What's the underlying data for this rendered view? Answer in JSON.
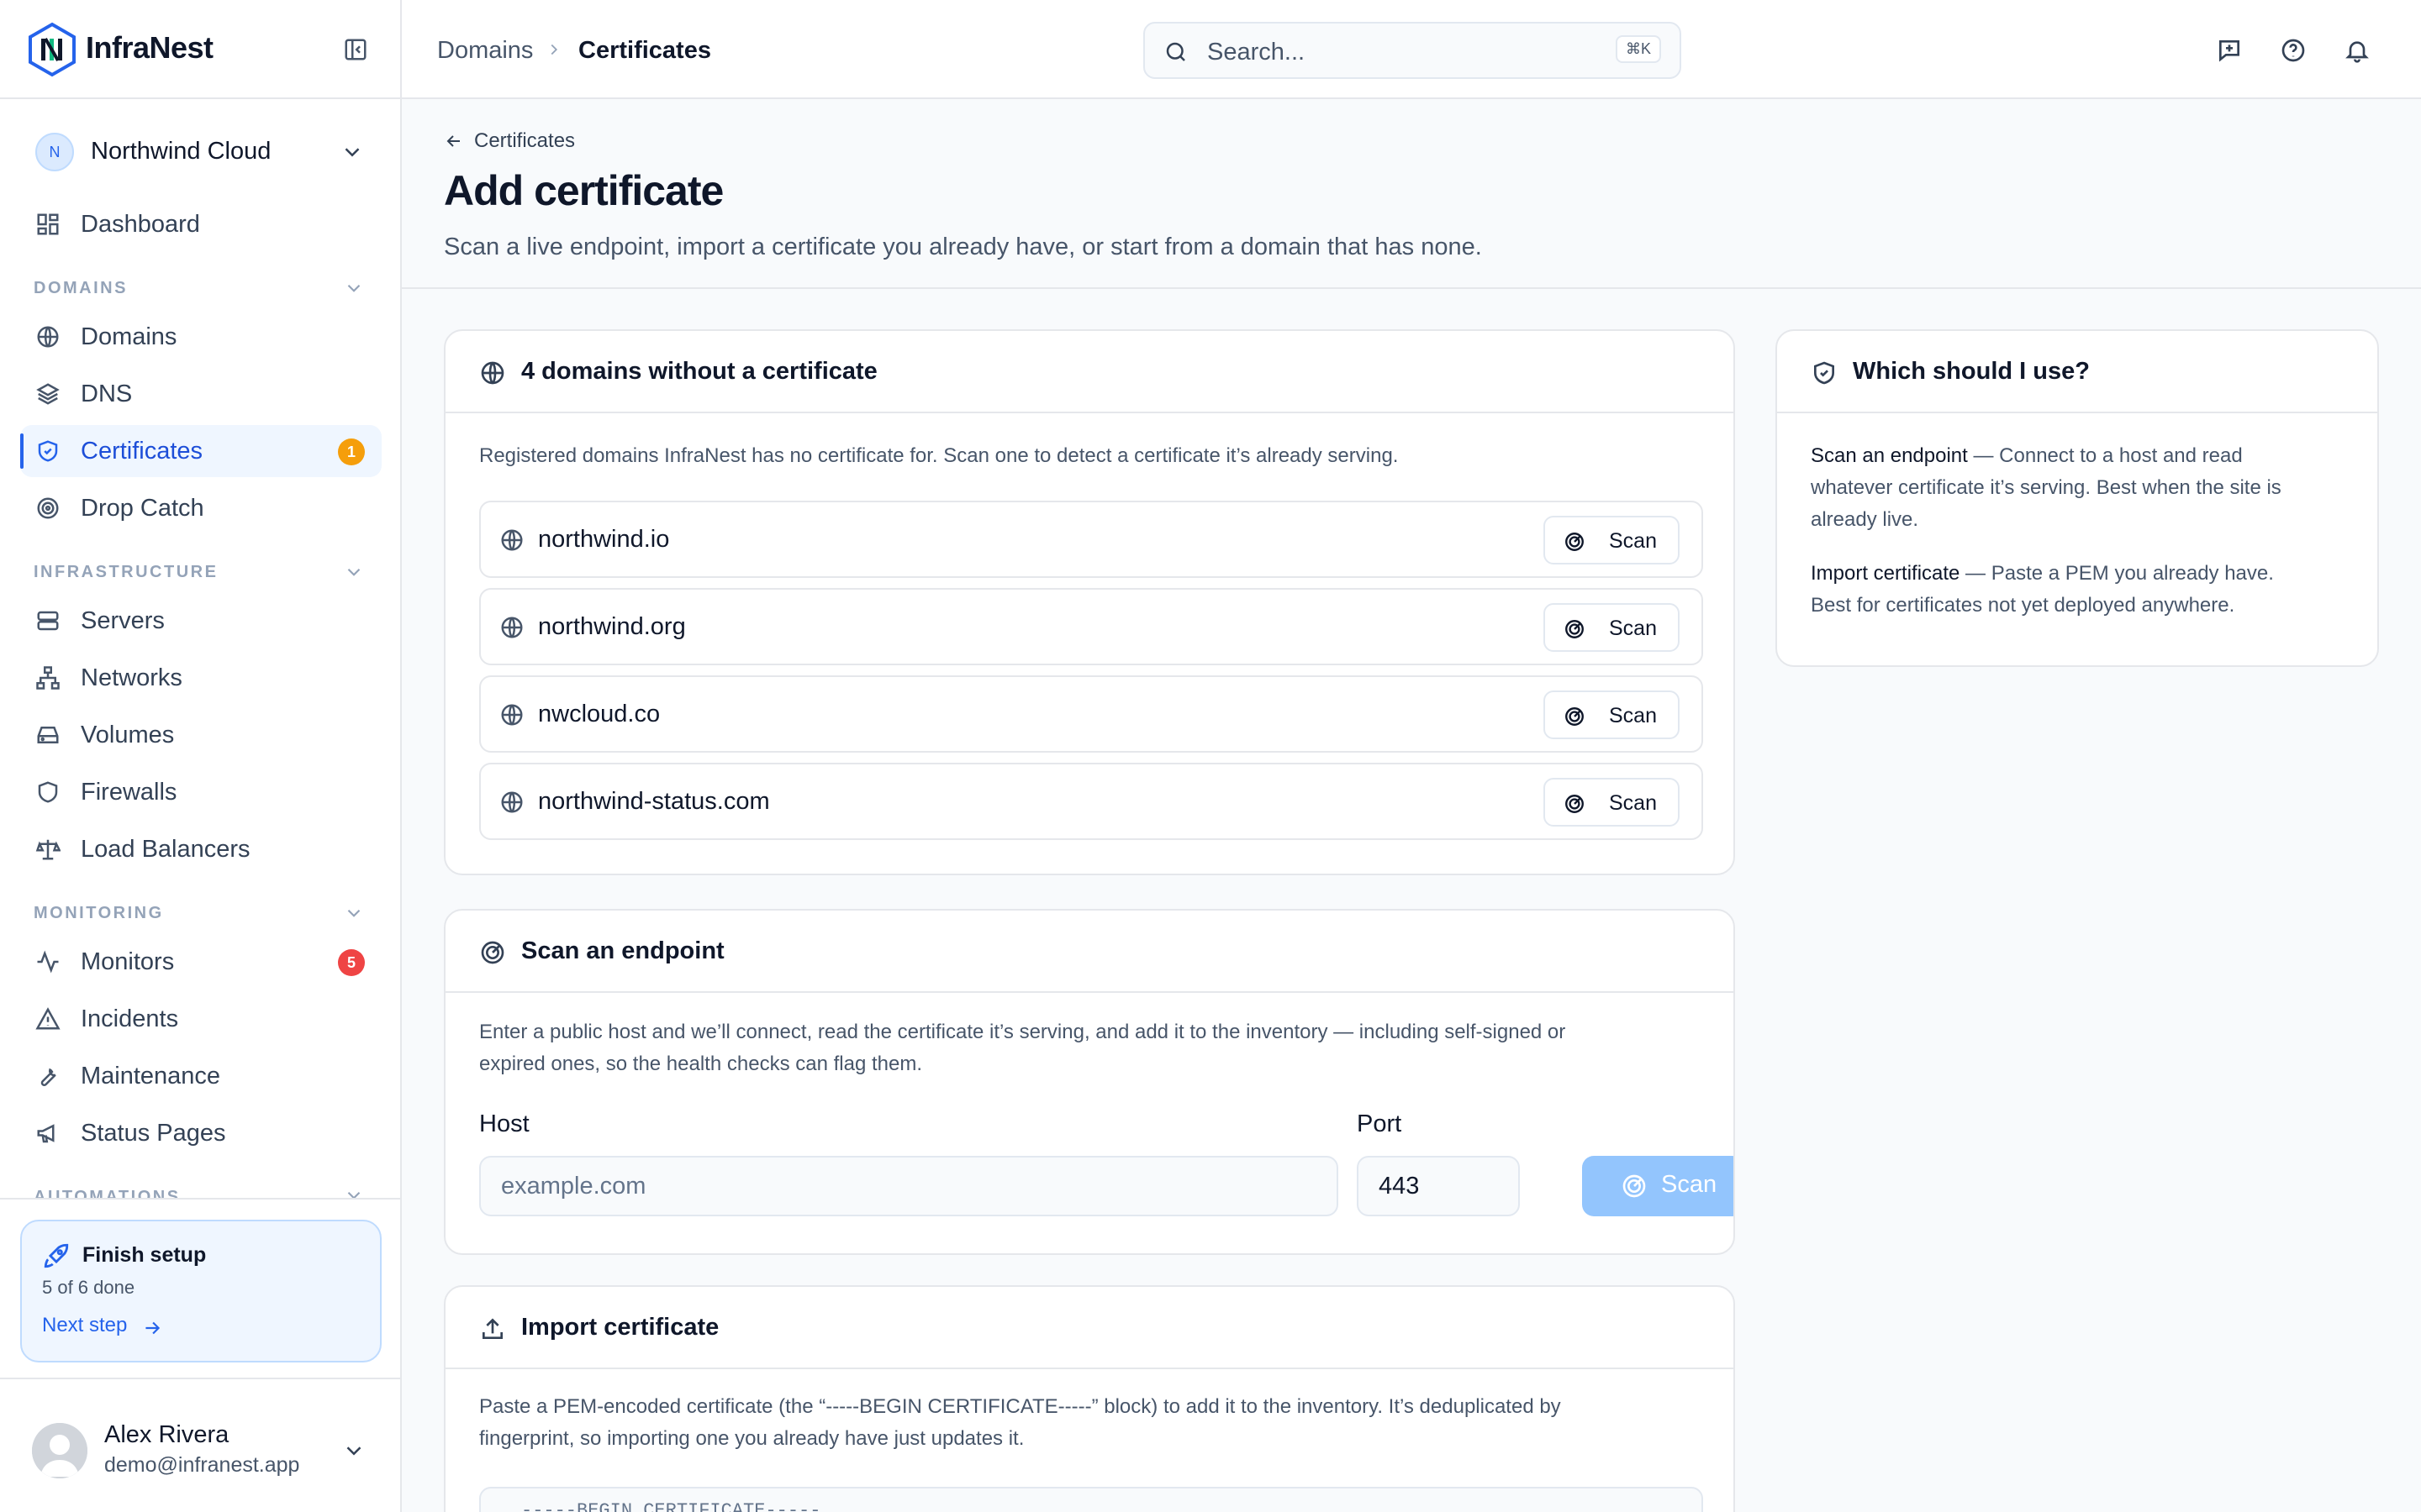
{
  "app": {
    "name": "InfraNest"
  },
  "org": {
    "initial": "N",
    "name": "Northwind Cloud"
  },
  "nav": {
    "dashboard": "Dashboard",
    "sections": {
      "domains": "DOMAINS",
      "infrastructure": "INFRASTRUCTURE",
      "monitoring": "MONITORING",
      "automations": "AUTOMATIONS"
    },
    "domains": "Domains",
    "dns": "DNS",
    "certificates": "Certificates",
    "certificates_badge": "1",
    "drop_catch": "Drop Catch",
    "servers": "Servers",
    "networks": "Networks",
    "volumes": "Volumes",
    "firewalls": "Firewalls",
    "load_balancers": "Load Balancers",
    "monitors": "Monitors",
    "monitors_badge": "5",
    "incidents": "Incidents",
    "maintenance": "Maintenance",
    "status_pages": "Status Pages"
  },
  "setup": {
    "title": "Finish setup",
    "progress": "5 of 6 done",
    "link": "Next step"
  },
  "user": {
    "name": "Alex Rivera",
    "email": "demo@infranest.app"
  },
  "header": {
    "breadcrumb": [
      "Domains",
      "Certificates"
    ],
    "search_placeholder": "Search...",
    "search_shortcut": "⌘K"
  },
  "page": {
    "back_label": "Certificates",
    "title": "Add certificate",
    "description": "Scan a live endpoint, import a certificate you already have, or start from a domain that has none."
  },
  "domains_card": {
    "title": "4 domains without a certificate",
    "description": "Registered domains InfraNest has no certificate for. Scan one to detect a certificate it’s already serving.",
    "scan_label": "Scan",
    "domains": [
      "northwind.io",
      "northwind.org",
      "nwcloud.co",
      "northwind-status.com"
    ]
  },
  "scan_card": {
    "title": "Scan an endpoint",
    "description_line1": "Enter a public host and we’ll connect, read the certificate it’s serving, and add it to the inventory — including self-signed or",
    "description_line2": "expired ones, so the health checks can flag them.",
    "host_label": "Host",
    "host_placeholder": "example.com",
    "port_label": "Port",
    "port_value": "443",
    "button_label": "Scan"
  },
  "import_card": {
    "title": "Import certificate",
    "description_line1": "Paste a PEM-encoded certificate (the “-----BEGIN CERTIFICATE-----” block) to add it to the inventory. It’s deduplicated by",
    "description_line2": "fingerprint, so importing one you already have just updates it.",
    "pem_placeholder": "-----BEGIN CERTIFICATE-----"
  },
  "help_card": {
    "title": "Which should I use?",
    "scan_term": "Scan an endpoint",
    "scan_line1": " — Connect to a host and read",
    "scan_line2": "whatever certificate it’s serving. Best when the site is",
    "scan_line3": "already live.",
    "import_term": "Import certificate",
    "import_line1": " — Paste a PEM you already have.",
    "import_line2": "Best for certificates not yet deployed anywhere."
  },
  "colors": {
    "accent": "#2563eb",
    "badge_warning": "#f59e0b",
    "badge_danger": "#ef4444",
    "primary_disabled": "#93c5fd"
  }
}
